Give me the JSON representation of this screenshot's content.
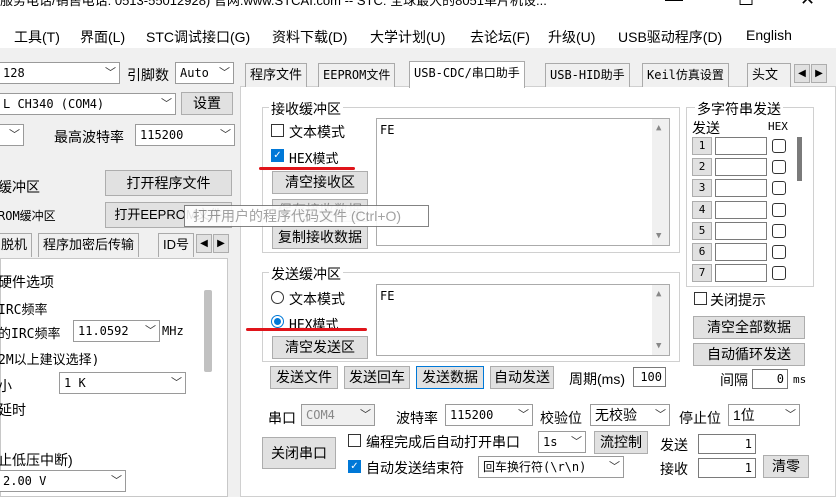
{
  "title": {
    "text": "服务电话/销售电话: 0513-55012928) 官网:www.STCAI.com  -- STC: 全球最大的8051单片机设..."
  },
  "menu": [
    "工具(T)",
    "界面(L)",
    "STC调试接口(G)",
    "资料下载(D)",
    "大学计划(U)",
    "去论坛(F)",
    "升级(U)",
    "USB驱动程序(D)",
    "English"
  ],
  "left": {
    "mcu_value": "128",
    "pin_label": "引脚数",
    "pin_value": "Auto",
    "port_value": "L CH340 (COM4)",
    "settings_button": "设置",
    "max_baud_label": "最高波特率",
    "max_baud_value": "115200",
    "program_buffer_label": "缓冲区",
    "open_program_button": "打开程序文件",
    "eeprom_buffer_label": "ROM缓冲区",
    "open_eeprom_button": "打开EEPROM文件",
    "tabs": [
      "脱机",
      "程序加密后传输",
      "ID号"
    ],
    "hw_options_label": "硬件选项",
    "irc_label": "IRC频率",
    "irc_freq_label": "的IRC频率",
    "irc_freq_value": "11.0592",
    "irc_unit": "MHz",
    "hint_12m": "2M以上建议选择)",
    "size_label": "小",
    "size_value": "1    K",
    "delay_label": "延时",
    "lowvolt_label": "止低压中断)",
    "voltage_value": "2.00 V"
  },
  "tooltip": "打开用户的程序代码文件 (Ctrl+O)",
  "tabs": [
    "程序文件",
    "EEPROM文件",
    "USB-CDC/串口助手",
    "USB-HID助手",
    "Keil仿真设置",
    "头文"
  ],
  "receive": {
    "group_title": "接收缓冲区",
    "text_mode": "文本模式",
    "hex_mode": "HEX模式",
    "clear_button": "清空接收区",
    "save_button": "保存接收数据",
    "copy_button": "复制接收数据",
    "content": "FE"
  },
  "send": {
    "group_title": "发送缓冲区",
    "text_mode": "文本模式",
    "hex_mode": "HEX模式",
    "clear_button": "清空发送区",
    "content": "FE",
    "send_file": "发送文件",
    "send_enter": "发送回车",
    "send_data": "发送数据",
    "auto_send": "自动发送",
    "period_label": "周期(ms)",
    "period_value": "100"
  },
  "multi": {
    "title": "多字符串发送",
    "send_header": "发送",
    "hex_header": "HEX",
    "rows": [
      "1",
      "2",
      "3",
      "4",
      "5",
      "6",
      "7"
    ],
    "close_hint": "关闭提示",
    "clear_all": "清空全部数据",
    "auto_loop": "自动循环发送",
    "interval_label": "间隔",
    "interval_value": "0",
    "interval_unit": "ms"
  },
  "serial": {
    "port_label": "串口",
    "port_value": "COM4",
    "baud_label": "波特率",
    "baud_value": "115200",
    "parity_label": "校验位",
    "parity_value": "无校验",
    "stop_label": "停止位",
    "stop_value": "1位",
    "close_port": "关闭串口",
    "auto_open_label": "编程完成后自动打开串口",
    "auto_open_value": "1s",
    "flow_control": "流控制",
    "auto_end_label": "自动发送结束符",
    "end_char_value": "回车换行符(\\r\\n)",
    "send_count_label": "发送",
    "send_count_value": "1",
    "recv_count_label": "接收",
    "recv_count_value": "1",
    "clear_count": "清零"
  },
  "colors": {
    "accent": "#0078d7",
    "highlight": "#e0141a"
  }
}
